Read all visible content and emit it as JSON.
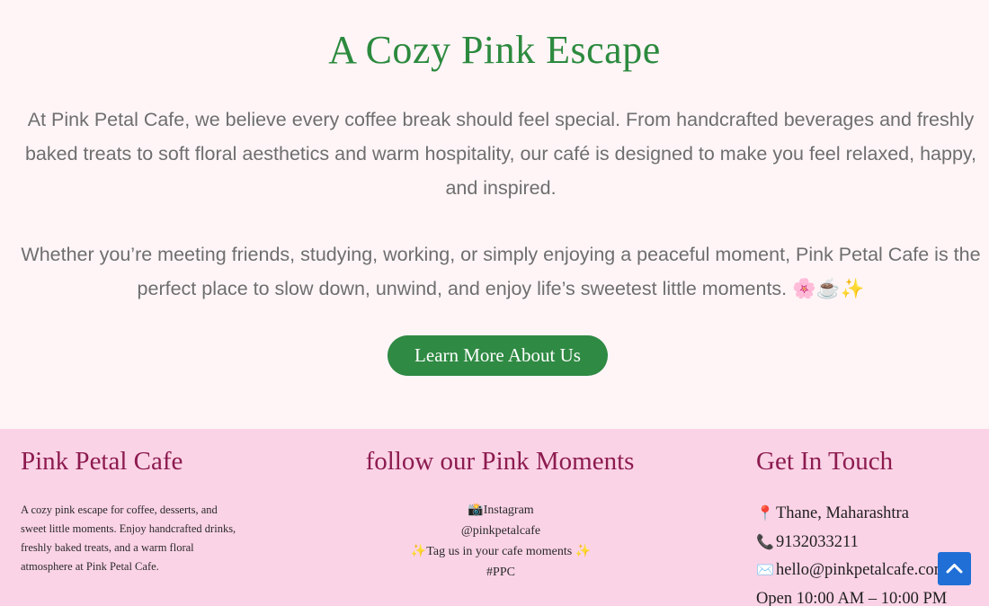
{
  "about": {
    "title": "A Cozy Pink Escape",
    "paragraph1": "At Pink Petal Cafe, we believe every coffee break should feel special. From handcrafted beverages and freshly baked treats to soft floral aesthetics and warm hospitality, our café is designed to make you feel relaxed, happy, and inspired.",
    "paragraph2": "Whether you’re meeting friends, studying, working, or simply enjoying a peaceful moment, Pink Petal Cafe is the perfect place to slow down, unwind, and enjoy life’s sweetest little moments. 🌸☕✨",
    "button_label": "Learn More About Us"
  },
  "footer": {
    "brand": {
      "heading": "Pink Petal Cafe",
      "description": "A cozy pink escape for coffee, desserts, and sweet little moments. Enjoy handcrafted drinks, freshly baked treats, and a warm floral atmosphere at Pink Petal Cafe."
    },
    "social": {
      "heading": "follow our Pink Moments",
      "instagram_label": "📸Instagram",
      "handle": "@pinkpetalcafe",
      "tag_line": "✨Tag us in your cafe moments ✨",
      "hashtag": "#PPC"
    },
    "contact": {
      "heading": "Get In Touch",
      "location_icon": "📍",
      "location": "Thane, Maharashtra",
      "phone_icon": "📞",
      "phone": "9132033211",
      "email_icon": "✉️",
      "email": "hello@pinkpetalcafe.com",
      "hours": "Open 10:00 AM – 10:00 PM"
    }
  },
  "colors": {
    "accent_green": "#2f8a43",
    "title_green": "#2c8a3e",
    "footer_pink": "#fbd3e6",
    "heading_plum": "#8c1b4f",
    "scroll_button_blue": "#1f6fd6"
  },
  "icons": {
    "scroll_top": "chevron-up-icon"
  }
}
